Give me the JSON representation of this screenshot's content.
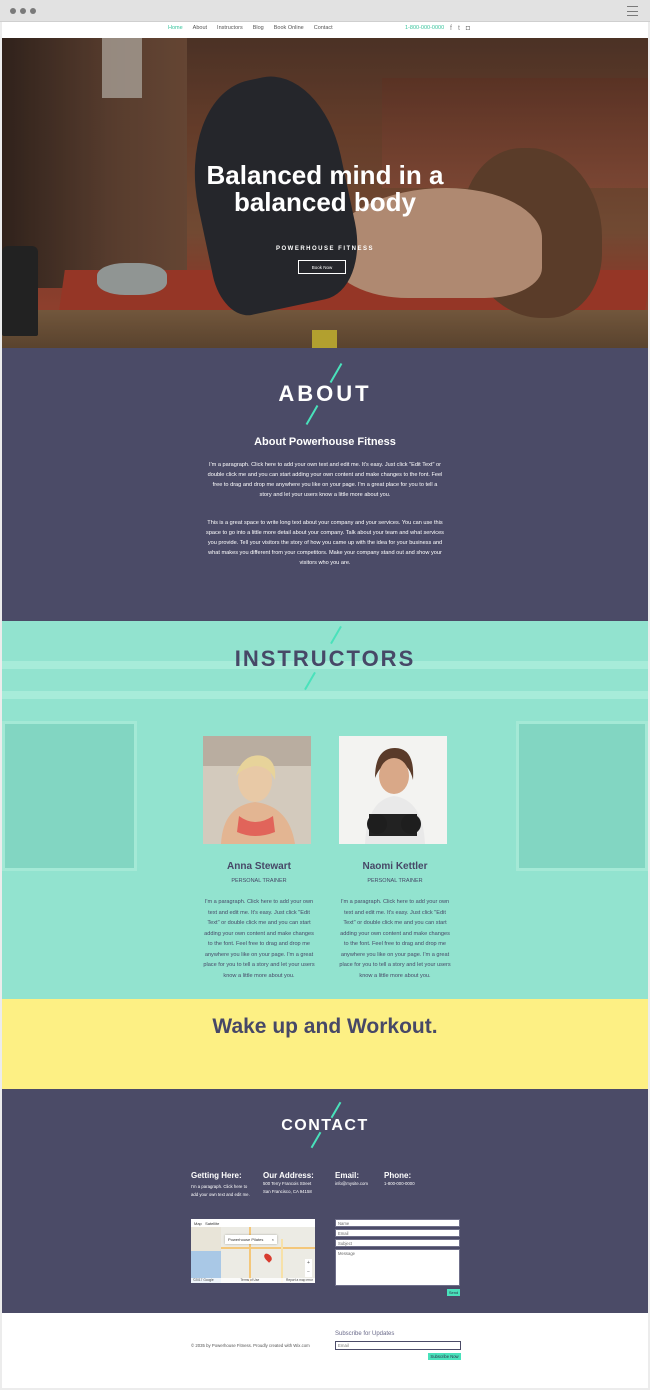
{
  "nav": {
    "items": [
      "Home",
      "About",
      "Instructors",
      "Blog",
      "Book Online",
      "Contact"
    ],
    "phone": "1-800-000-0000",
    "social": [
      {
        "icon": "facebook-icon",
        "glyph": "f"
      },
      {
        "icon": "twitter-icon",
        "glyph": "t"
      },
      {
        "icon": "instagram-icon",
        "glyph": "◘"
      }
    ]
  },
  "hero": {
    "title_line1": "Balanced mind in a",
    "title_line2": "balanced body",
    "subtitle": "POWERHOUSE FITNESS",
    "button": "Book Now"
  },
  "about": {
    "title": "ABOUT",
    "heading": "About Powerhouse Fitness",
    "p1": "I'm a paragraph. Click here to add your own text and edit me. It's easy. Just click \"Edit Text\" or double click me and you can start adding your own content and make changes to the font. Feel free to drag and drop me anywhere you like on your page. I'm a great place for you to tell a story and let your users know a little more about you.",
    "p2": "This is a great space to write long text about your company and your services. You can use this space to go into a little more detail about your company. Talk about your team and what services you provide. Tell your visitors the story of how you came up with the idea for your business and what makes you different from your competitors. Make your company stand out and show your visitors who you are."
  },
  "instructors": {
    "title": "INSTRUCTORS",
    "people": [
      {
        "name": "Anna Stewart",
        "role": "PERSONAL TRAINER",
        "bio": "I'm a paragraph. Click here to add your own text and edit me. It's easy. Just click \"Edit Text\" or double click me and you can start adding your own content and make changes to the font. Feel free to drag and drop me anywhere you like on your page. I'm a great place for you to tell a story and let your users know a little more about you."
      },
      {
        "name": "Naomi Kettler",
        "role": "PERSONAL TRAINER",
        "bio": "I'm a paragraph. Click here to add your own text and edit me. It's easy. Just click \"Edit Text\" or double click me and you can start adding your own content and make changes to the font. Feel free to drag and drop me anywhere you like on your page. I'm a great place for you to tell a story and let your users know a little more about you."
      }
    ]
  },
  "wake": {
    "text": "Wake up and Workout."
  },
  "contact": {
    "title": "CONTACT",
    "getting_here": {
      "heading": "Getting Here:",
      "text": "I'm a paragraph. Click here to add your own text and edit me."
    },
    "address": {
      "heading": "Our Address:",
      "line1": "500 Terry Francois Street",
      "line2": "San Francisco, CA 94158"
    },
    "email": {
      "heading": "Email:",
      "value": "info@mysite.com"
    },
    "phone": {
      "heading": "Phone:",
      "value": "1-800-000-0000"
    },
    "map": {
      "tab_map": "Map",
      "tab_satellite": "Satellite",
      "place": "Powerhouse Pilates",
      "footer_left": "©2017 Google",
      "footer_terms": "Terms of Use",
      "footer_report": "Report a map error"
    },
    "form": {
      "name": "Name",
      "email": "Email",
      "subject": "Subject",
      "message": "Message",
      "send": "Send"
    }
  },
  "footer": {
    "copyright": "© 2035 by Powerhouse Fitness. Proudly created with Wix.com",
    "subscribe_title": "Subscribe for Updates",
    "subscribe_placeholder": "Email",
    "subscribe_button": "Subscribe Now"
  },
  "colors": {
    "accent": "#49e2bb",
    "navy": "#4b4b67",
    "mint": "#92e3cf",
    "yellow": "#fdf084"
  }
}
